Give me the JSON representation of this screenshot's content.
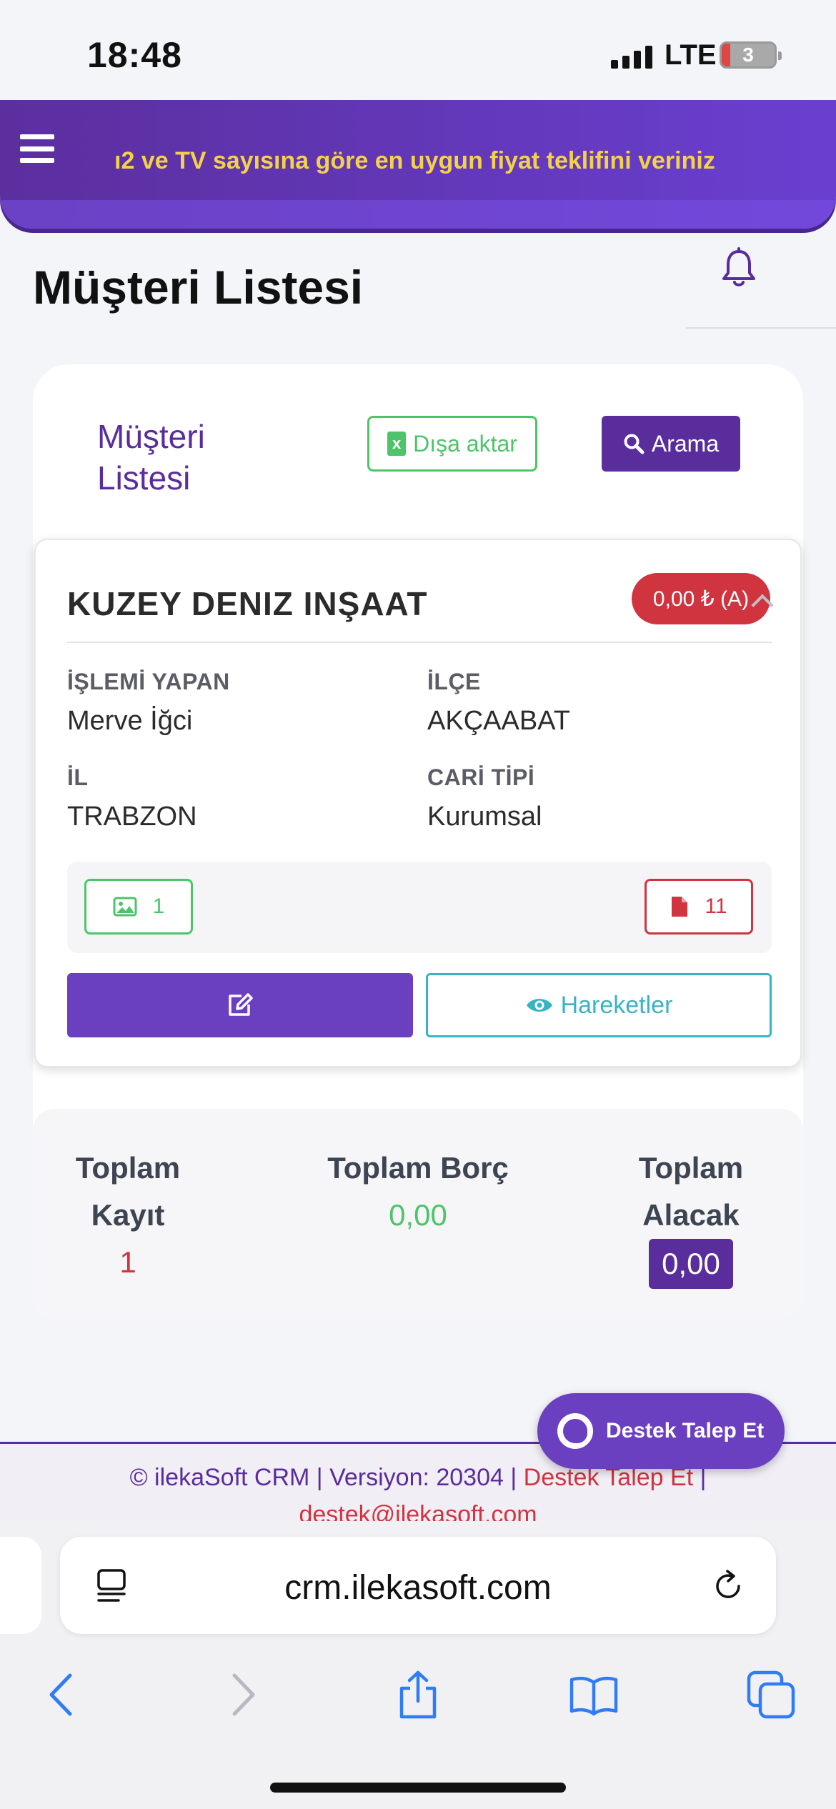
{
  "status_bar": {
    "time": "18:48",
    "network": "LTE",
    "battery": "3"
  },
  "banner": {
    "marquee": "ı2 ve TV sayısına göre en uygun fiyat teklifini veriniz"
  },
  "page": {
    "title": "Müşteri Listesi"
  },
  "card": {
    "heading_line1": "Müşteri",
    "heading_line2": "Listesi",
    "export_label": "Dışa aktar",
    "search_label": "Arama"
  },
  "customer": {
    "name": "KUZEY DENIZ INŞAAT",
    "balance": "0,00 ₺ (A)",
    "fields": [
      {
        "label": "İŞLEMİ YAPAN",
        "value": "Merve İğci"
      },
      {
        "label": "İLÇE",
        "value": "AKÇAABAT"
      },
      {
        "label": "İL",
        "value": "TRABZON"
      },
      {
        "label": "CARİ TİPİ",
        "value": "Kurumsal"
      }
    ],
    "image_count": "1",
    "document_count": "11",
    "moves_label": "Hareketler"
  },
  "totals": {
    "record_label_1": "Toplam",
    "record_label_2": "Kayıt",
    "record_value": "1",
    "debt_label": "Toplam Borç",
    "debt_value": "0,00",
    "credit_label_1": "Toplam",
    "credit_label_2": "Alacak",
    "credit_value": "0,00"
  },
  "footer": {
    "prefix": "© ilekaSoft CRM | Versiyon: 20304 | ",
    "support_link": "Destek Talep Et",
    "suffix": " |",
    "email": "destek@ilekasoft.com"
  },
  "support_button": {
    "label": "Destek Talep Et"
  },
  "browser": {
    "url": "crm.ilekasoft.com"
  },
  "colors": {
    "brand": "#5a2d9c",
    "accent": "#6a3fc0",
    "success": "#4ec46a",
    "danger": "#d0343f",
    "info": "#38b3c2",
    "marquee": "#f3d24a"
  },
  "icons": [
    "hamburger-icon",
    "bell-icon",
    "excel-icon",
    "search-icon",
    "image-icon",
    "document-icon",
    "edit-icon",
    "eye-icon",
    "lifebuoy-icon",
    "reader-icon",
    "reload-icon",
    "back-icon",
    "forward-icon",
    "share-icon",
    "bookmarks-icon",
    "tabs-icon"
  ]
}
